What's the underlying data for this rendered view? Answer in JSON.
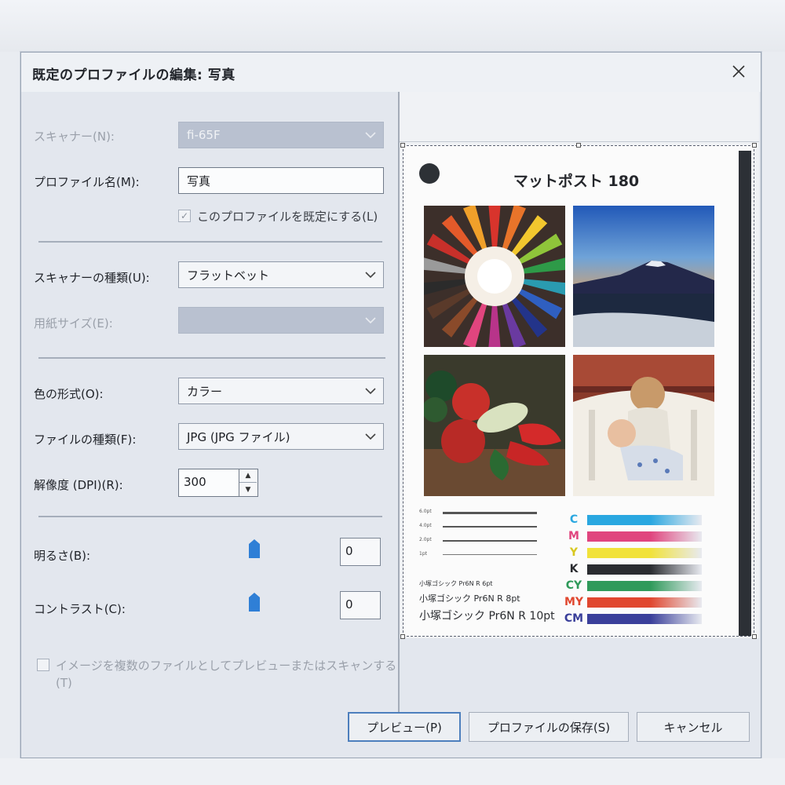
{
  "dialog": {
    "title": "既定のプロファイルの編集: 写真",
    "close_icon": "close-icon"
  },
  "form": {
    "scanner_label": "スキャナー(N):",
    "scanner_value": "fi-65F",
    "profile_name_label": "プロファイル名(M):",
    "profile_name_value": "写真",
    "default_checkbox_label": "このプロファイルを既定にする(L)",
    "default_checkbox_checked": true,
    "scanner_type_label": "スキャナーの種類(U):",
    "scanner_type_value": "フラットベット",
    "paper_size_label": "用紙サイズ(E):",
    "paper_size_value": "",
    "color_format_label": "色の形式(O):",
    "color_format_value": "カラー",
    "file_type_label": "ファイルの種類(F):",
    "file_type_value": "JPG (JPG ファイル)",
    "resolution_label": "解像度 (DPI)(R):",
    "resolution_value": "300",
    "brightness_label": "明るさ(B):",
    "brightness_value": "0",
    "contrast_label": "コントラスト(C):",
    "contrast_value": "0",
    "multi_file_label_line1": "イメージを複数のファイルとしてプレビューまたはスキャンする",
    "multi_file_label_line2": "(T)",
    "multi_file_checked": false
  },
  "preview": {
    "sheet_title": "マットポスト 180",
    "type_samples": [
      "小塚ゴシック Pr6N R 6pt",
      "小塚ゴシック Pr6N R 8pt",
      "小塚ゴシック Pr6N R 10pt"
    ],
    "line_labels": [
      "6.0pt",
      "4.0pt",
      "2.0pt",
      "1pt"
    ],
    "color_bars": [
      {
        "label": "C",
        "color": "#2aa7e0",
        "label_color": "#2aa7e0"
      },
      {
        "label": "M",
        "color": "#e0457e",
        "label_color": "#e0457e"
      },
      {
        "label": "Y",
        "color": "#f1e23a",
        "label_color": "#d8c820"
      },
      {
        "label": "K",
        "color": "#2a2c30",
        "label_color": "#2a2c30"
      },
      {
        "label": "CY",
        "color": "#2f9a5a",
        "label_color": "#2f9a5a"
      },
      {
        "label": "MY",
        "color": "#e0472f",
        "label_color": "#e0472f"
      },
      {
        "label": "CM",
        "color": "#3a3f9a",
        "label_color": "#3a3f9a"
      }
    ]
  },
  "buttons": {
    "preview": "プレビュー(P)",
    "save_profile": "プロファイルの保存(S)",
    "cancel": "キャンセル"
  },
  "colors": {
    "dialog_bg": "#e3e7ee",
    "disabled_field": "#b9c1d0",
    "slider_thumb": "#2f7fd6",
    "default_button_border": "#4d7fbd"
  }
}
